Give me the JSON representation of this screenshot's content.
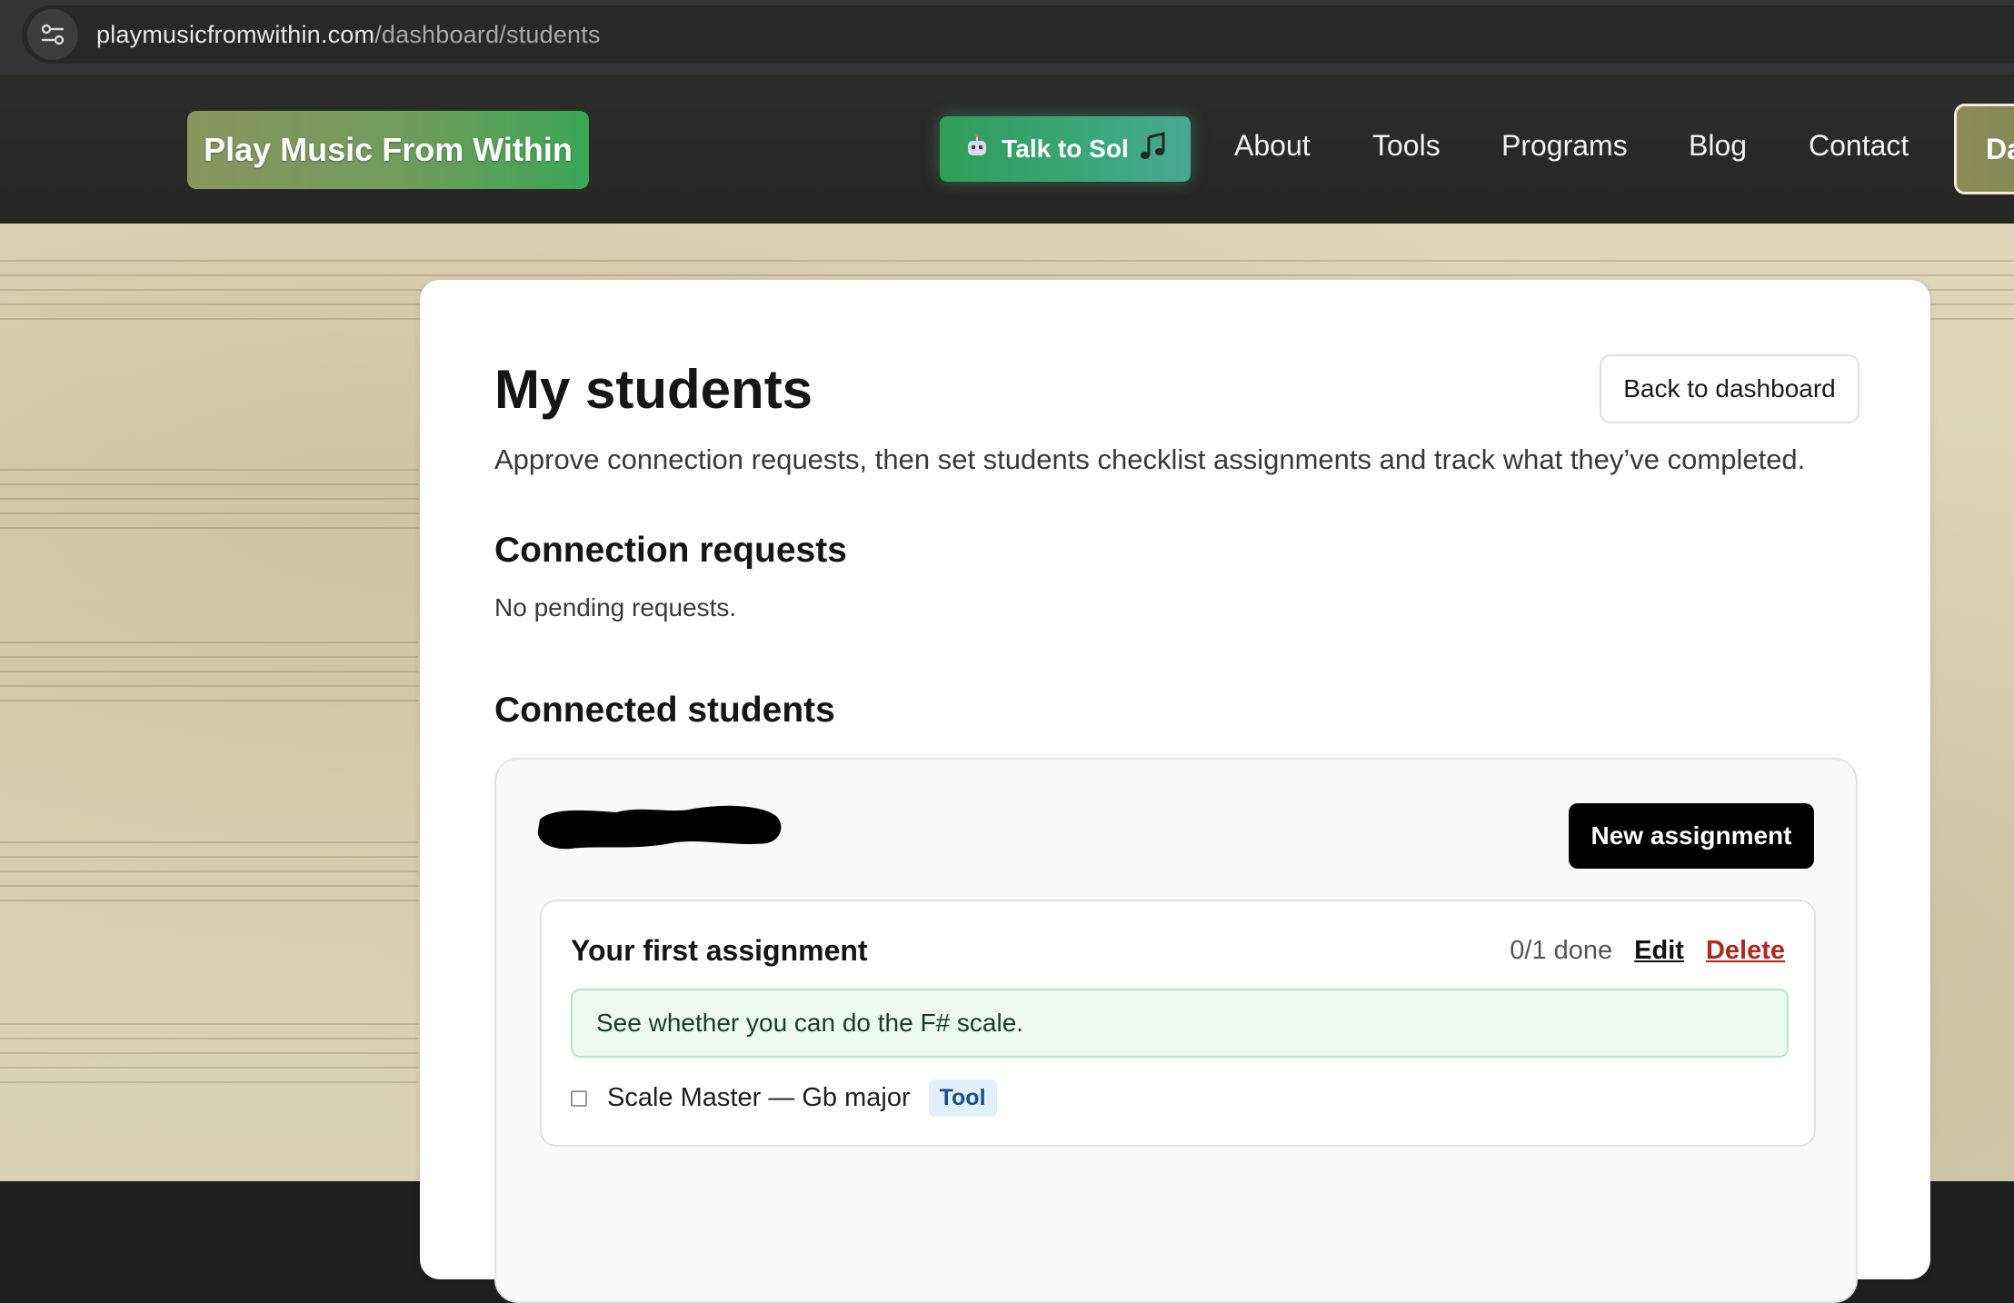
{
  "browser": {
    "url_host": "playmusicfromwithin.com",
    "url_path": "/dashboard/students"
  },
  "header": {
    "logo_label": "Play Music From Within",
    "sol_button_label": "Talk to Sol",
    "sol_icon_left": "robot-icon",
    "sol_icon_right": "music-note-icon",
    "nav": [
      {
        "label": "About"
      },
      {
        "label": "Tools"
      },
      {
        "label": "Programs"
      },
      {
        "label": "Blog"
      },
      {
        "label": "Contact"
      }
    ],
    "dashboard_label_partial": "Da"
  },
  "page": {
    "title": "My students",
    "back_button": "Back to dashboard",
    "subtitle": "Approve connection requests, then set students checklist assignments and track what they’ve completed.",
    "connection_requests": {
      "heading": "Connection requests",
      "empty_text": "No pending requests."
    },
    "connected_students": {
      "heading": "Connected students",
      "students": [
        {
          "name_redacted": true,
          "new_assignment_label": "New assignment",
          "assignments": [
            {
              "title": "Your first assignment",
              "progress": "0/1 done",
              "edit_label": "Edit",
              "delete_label": "Delete",
              "note": "See whether you can do the F# scale.",
              "tasks": [
                {
                  "label": "Scale Master — Gb major",
                  "badge": "Tool",
                  "checked": false
                }
              ]
            }
          ]
        }
      ]
    }
  },
  "colors": {
    "accent_green": "#3aa655",
    "delete_red": "#b3261e",
    "note_bg": "#ecf8f0",
    "badge_bg": "#e3f0fb"
  }
}
